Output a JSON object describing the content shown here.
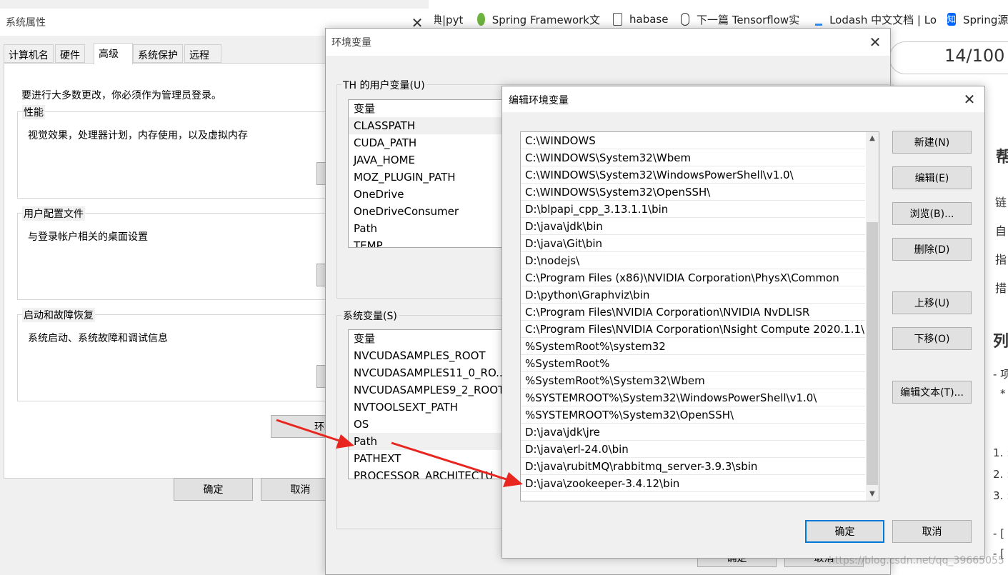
{
  "browser": {
    "bookmarks": [
      {
        "label": "典|pyt",
        "icon": "partial-icon"
      },
      {
        "label": "Spring Framework文",
        "icon": "spring-leaf-icon"
      },
      {
        "label": "habase",
        "icon": "page-icon"
      },
      {
        "label": "下一篇 Tensorflow实",
        "icon": "mouse-icon"
      },
      {
        "label": "Lodash 中文文档 | Lo",
        "icon": "lodash-icon"
      },
      {
        "label": "Spring源",
        "icon": "zhihu-icon"
      }
    ],
    "counter": "14/100",
    "right_fragments": [
      "帮",
      "链",
      "自",
      "指",
      "措",
      "列",
      "- 项",
      "*",
      "1. :",
      "2. :",
      "3. :",
      "- [",
      "- ["
    ]
  },
  "sysprops": {
    "title": "系统属性",
    "tabs": [
      "计算机名",
      "硬件",
      "高级",
      "系统保护",
      "远程"
    ],
    "admin_note": "要进行大多数更改，你必须作为管理员登录。",
    "groups": [
      {
        "label": "性能",
        "desc": "视觉效果，处理器计划，内存使用，以及虚拟内存"
      },
      {
        "label": "用户配置文件",
        "desc": "与登录帐户相关的桌面设置"
      },
      {
        "label": "启动和故障恢复",
        "desc": "系统启动、系统故障和调试信息"
      }
    ],
    "env_button": "环境",
    "ok": "确定",
    "cancel": "取消"
  },
  "envvars": {
    "title": "环境变量",
    "user_section": "TH 的用户变量(U)",
    "user_header": "变量",
    "user_vars": [
      "CLASSPATH",
      "CUDA_PATH",
      "JAVA_HOME",
      "MOZ_PLUGIN_PATH",
      "OneDrive",
      "OneDriveConsumer",
      "Path",
      "TEMP"
    ],
    "sys_section": "系统变量(S)",
    "sys_header": "变量",
    "sys_vars": [
      "NVCUDASAMPLES_ROOT",
      "NVCUDASAMPLES11_0_RO...",
      "NVCUDASAMPLES9_2_ROOT",
      "NVTOOLSEXT_PATH",
      "OS",
      "Path",
      "PATHEXT",
      "PROCESSOR_ARCHITECTU"
    ],
    "ok_partial": "确定",
    "cancel_partial": "取消"
  },
  "editenv": {
    "title": "编辑环境变量",
    "paths": [
      "C:\\WINDOWS",
      "C:\\WINDOWS\\System32\\Wbem",
      "C:\\WINDOWS\\System32\\WindowsPowerShell\\v1.0\\",
      "C:\\WINDOWS\\System32\\OpenSSH\\",
      "D:\\blpapi_cpp_3.13.1.1\\bin",
      "D:\\java\\jdk\\bin",
      "D:\\java\\Git\\bin",
      "D:\\nodejs\\",
      "C:\\Program Files (x86)\\NVIDIA Corporation\\PhysX\\Common",
      "D:\\python\\Graphviz\\bin",
      "C:\\Program Files\\NVIDIA Corporation\\NVIDIA NvDLISR",
      "C:\\Program Files\\NVIDIA Corporation\\Nsight Compute 2020.1.1\\",
      "%SystemRoot%\\system32",
      "%SystemRoot%",
      "%SystemRoot%\\System32\\Wbem",
      "%SYSTEMROOT%\\System32\\WindowsPowerShell\\v1.0\\",
      "%SYSTEMROOT%\\System32\\OpenSSH\\",
      "D:\\java\\jdk\\jre",
      "D:\\java\\erl-24.0\\bin",
      "D:\\java\\rubitMQ\\rabbitmq_server-3.9.3\\sbin",
      "D:\\java\\zookeeper-3.4.12\\bin"
    ],
    "buttons": {
      "new": "新建(N)",
      "edit": "编辑(E)",
      "browse": "浏览(B)...",
      "delete": "删除(D)",
      "up": "上移(U)",
      "down": "下移(O)",
      "edit_text": "编辑文本(T)..."
    },
    "ok": "确定",
    "cancel": "取消"
  },
  "annotation_color": "#e8251f",
  "watermark": "https://blog.csdn.net/qq_39665055"
}
